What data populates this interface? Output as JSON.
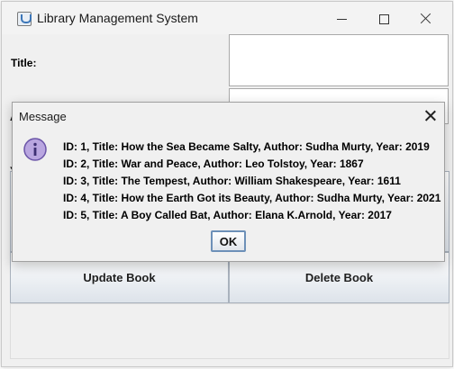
{
  "window": {
    "title": "Library Management System"
  },
  "form": {
    "title_label": "Title:",
    "author_label_partial": "A",
    "year_label_partial": "Y",
    "title_value": "",
    "author_value": ""
  },
  "buttons": {
    "update_label": "Update Book",
    "delete_label": "Delete Book"
  },
  "dialog": {
    "title": "Message",
    "icon": "info-icon",
    "lines": [
      "ID: 1, Title: How the Sea Became Salty, Author: Sudha Murty, Year: 2019",
      "ID: 2, Title: War and Peace, Author: Leo Tolstoy, Year: 1867",
      "ID: 3, Title: The Tempest, Author: William Shakespeare, Year: 1611",
      "ID: 4, Title: How the Earth Got its Beauty, Author: Sudha Murty, Year: 2021",
      "ID: 5, Title: A Boy Called Bat, Author: Elana K.Arnold, Year: 2017"
    ],
    "ok_label": "OK"
  },
  "colors": {
    "info_icon_fill": "#b9a6e0",
    "info_icon_stroke": "#6b55a8",
    "ok_border": "#6d90b8"
  }
}
